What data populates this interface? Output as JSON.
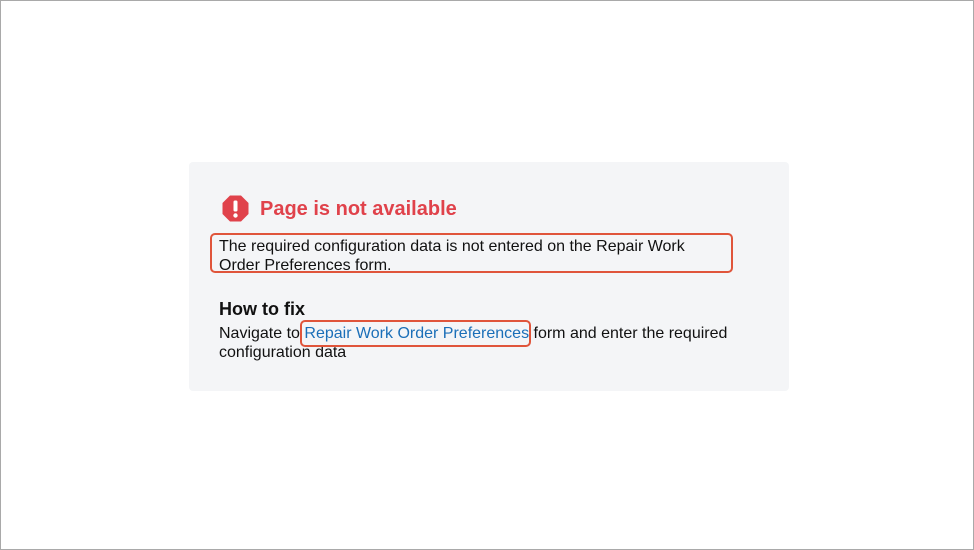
{
  "error": {
    "icon": "error-exclamation-icon",
    "icon_color": "#e0424b",
    "title": "Page is not available",
    "message": "The required configuration data is not entered on the Repair Work Order Preferences form."
  },
  "fix": {
    "heading": "How to fix",
    "prefix": "Navigate to ",
    "link_label": "Repair Work Order Preferences",
    "suffix": " form and enter the required configuration data"
  },
  "colors": {
    "title": "#e0424b",
    "link": "#1b6fb8",
    "highlight": "#e0553b",
    "card_background": "#f4f5f7"
  }
}
